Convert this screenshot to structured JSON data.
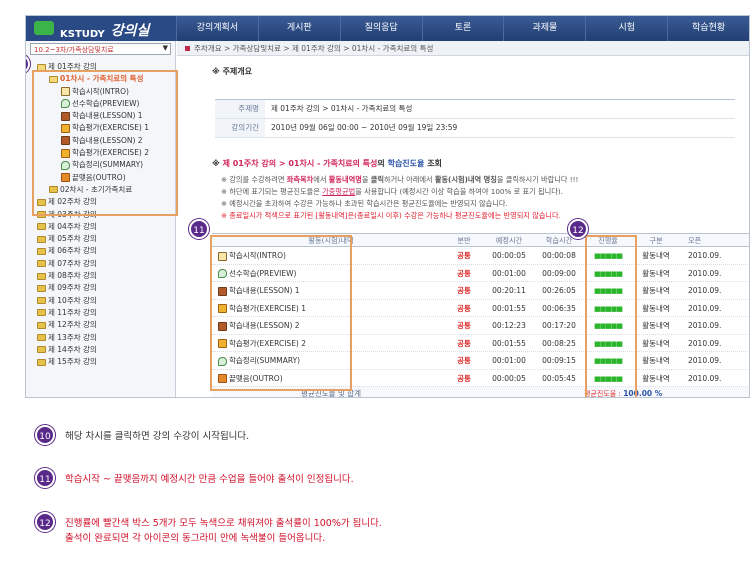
{
  "logo": {
    "text": "KSTUDY",
    "script": "강의실"
  },
  "topnav": [
    "강의계획서",
    "게시판",
    "질의응답",
    "토론",
    "과제물",
    "시험",
    "학습현황"
  ],
  "sidebar": {
    "select_value": "10.2~3차/가족상담및치료",
    "week1": "제 01주차 강의",
    "session1": "01차시 - 가족치료의 특성",
    "items": [
      "학습시작(INTRO)",
      "선수학습(PREVIEW)",
      "학습내용(LESSON) 1",
      "학습평가(EXERCISE) 1",
      "학습내용(LESSON) 2",
      "학습평가(EXERCISE) 2",
      "학습정리(SUMMARY)",
      "끝맺음(OUTRO)"
    ],
    "session2": "02차시 - 초기가족치료",
    "weeks": [
      "제 02주차 강의",
      "제 03주차 강의",
      "제 04주차 강의",
      "제 05주차 강의",
      "제 06주차 강의",
      "제 07주차 강의",
      "제 08주차 강의",
      "제 09주차 강의",
      "제 10주차 강의",
      "제 11주차 강의",
      "제 12주차 강의",
      "제 13주차 강의",
      "제 14주차 강의",
      "제 15주차 강의"
    ]
  },
  "breadcrumb": "주차개요 > 가족상담및치료 > 제 01주차 강의 > 01차시 - 가족치료의 특성",
  "overview": {
    "title": "※ 주제개요",
    "rows": [
      {
        "label": "주제명",
        "value": "제 01주차 강의 > 01차시 - 가족치료의 특성"
      },
      {
        "label": "강의기간",
        "value": "2010년 09월 06일 00:00 ~ 2010년 09월 19일 23:59"
      }
    ]
  },
  "course_head": {
    "prefix": "※",
    "path": "제 01주차 강의 > 01차시 - 가족치료의 특성",
    "mid": "의",
    "key": "학습진도율",
    "suffix": "조회"
  },
  "notes": [
    {
      "a": "※ 강의를 수강하려면 ",
      "b": "좌측목차",
      "c": "에서 ",
      "d": "활동내역명",
      "e": "을 ",
      "f": "클릭",
      "g": "하거나 아래에서 ",
      "h": "활동(시험)내역 명칭",
      "i": "을 클릭하시기 바랍니다 !!!"
    },
    {
      "a": "※ 하단에 표기되는 평균진도율은 ",
      "b": "가중평균법",
      "c": "을 사용합니다 (예정시간 이상 학습을 하여야 100% 로 표기 됩니다)."
    },
    {
      "a": "※ 예정시간을 초과하여 수강은 가능하나 초과된 학습시간은 평균진도율에는 반영되지 않습니다."
    },
    {
      "a": "※ 종료일시가 적색으로 표기된 [활동내역]은(종료일시 이후) 수강은 가능하나 평균진도율에는 반영되지 않습니다."
    }
  ],
  "table": {
    "headers": [
      "활동(시험)내역",
      "분반",
      "예정시간",
      "학습시간",
      "진행율",
      "구분",
      "오픈"
    ],
    "rows": [
      {
        "name": "학습시작(INTRO)",
        "class": "공통",
        "plan": "00:00:05",
        "study": "00:00:08",
        "progress": "■■■■■",
        "type": "활동내역",
        "open": "2010.09."
      },
      {
        "name": "선수학습(PREVIEW)",
        "class": "공통",
        "plan": "00:01:00",
        "study": "00:09:00",
        "progress": "■■■■■",
        "type": "활동내역",
        "open": "2010.09."
      },
      {
        "name": "학습내용(LESSON) 1",
        "class": "공통",
        "plan": "00:20:11",
        "study": "00:26:05",
        "progress": "■■■■■",
        "type": "활동내역",
        "open": "2010.09."
      },
      {
        "name": "학습평가(EXERCISE) 1",
        "class": "공통",
        "plan": "00:01:55",
        "study": "00:06:35",
        "progress": "■■■■■",
        "type": "활동내역",
        "open": "2010.09."
      },
      {
        "name": "학습내용(LESSON) 2",
        "class": "공통",
        "plan": "00:12:23",
        "study": "00:17:20",
        "progress": "■■■■■",
        "type": "활동내역",
        "open": "2010.09."
      },
      {
        "name": "학습평가(EXERCISE) 2",
        "class": "공통",
        "plan": "00:01:55",
        "study": "00:08:25",
        "progress": "■■■■■",
        "type": "활동내역",
        "open": "2010.09."
      },
      {
        "name": "학습정리(SUMMARY)",
        "class": "공통",
        "plan": "00:01:00",
        "study": "00:09:15",
        "progress": "■■■■■",
        "type": "활동내역",
        "open": "2010.09."
      },
      {
        "name": "끝맺음(OUTRO)",
        "class": "공통",
        "plan": "00:00:05",
        "study": "00:05:45",
        "progress": "■■■■■",
        "type": "활동내역",
        "open": "2010.09."
      }
    ],
    "footer_label": "평균진도율 및 합계",
    "footer_avg_label": "평균진도율 :",
    "footer_avg_value": "100.00 %"
  },
  "badges": [
    "10",
    "11",
    "12"
  ],
  "legend": [
    {
      "num": "10",
      "text": "해당 차시를 클릭하면 강의 수강이 시작됩니다.",
      "color": "#333333"
    },
    {
      "num": "11",
      "text": "학습시작 ~ 끝맺음까지 예정시간 만큼 수업을 들어야 출석이 인정됩니다.",
      "color": "#d0102a"
    },
    {
      "num": "12",
      "text": "진행률에 빨간색 박스 5개가 모두 녹색으로 채워져야 출석률이 100%가 됩니다.",
      "text2": "출석이 완료되면 각 아이콘의 동그라미 안에 녹색불이 들어옵니다.",
      "color": "#d0102a"
    }
  ]
}
